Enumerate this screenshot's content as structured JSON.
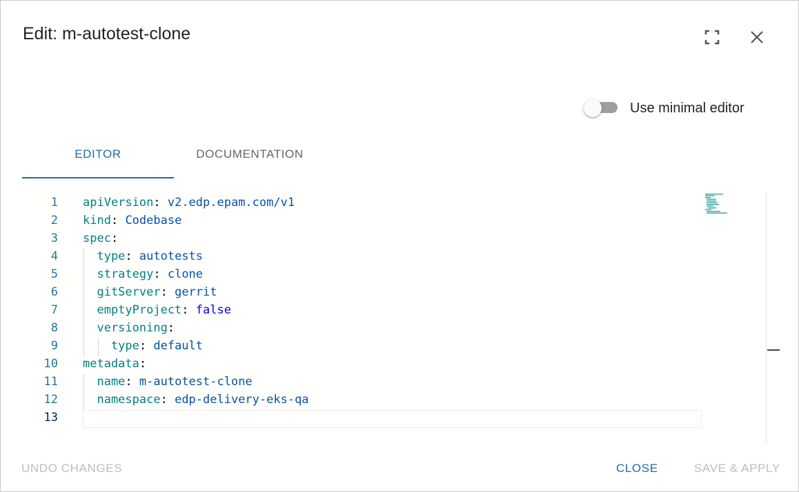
{
  "dialog": {
    "title": "Edit: m-autotest-clone",
    "icons": {
      "fullscreen": "fullscreen-icon",
      "close": "close-icon"
    }
  },
  "toggle": {
    "label": "Use minimal editor",
    "checked": false
  },
  "tabs": [
    {
      "label": "EDITOR",
      "active": true
    },
    {
      "label": "DOCUMENTATION",
      "active": false
    }
  ],
  "editor": {
    "lines": [
      {
        "num": "1",
        "key": "apiVersion",
        "sep": ":",
        "value": " v2.edp.epam.com/v1",
        "vtype": "v"
      },
      {
        "num": "2",
        "key": "kind",
        "sep": ":",
        "value": " Codebase",
        "vtype": "v"
      },
      {
        "num": "3",
        "key": "spec",
        "sep": ":",
        "value": "",
        "vtype": "v"
      },
      {
        "num": "4",
        "key": "  type",
        "sep": ":",
        "value": " autotests",
        "vtype": "v"
      },
      {
        "num": "5",
        "key": "  strategy",
        "sep": ":",
        "value": " clone",
        "vtype": "v"
      },
      {
        "num": "6",
        "key": "  gitServer",
        "sep": ":",
        "value": " gerrit",
        "vtype": "v"
      },
      {
        "num": "7",
        "key": "  emptyProject",
        "sep": ":",
        "value": " false",
        "vtype": "b"
      },
      {
        "num": "8",
        "key": "  versioning",
        "sep": ":",
        "value": "",
        "vtype": "v"
      },
      {
        "num": "9",
        "key": "    type",
        "sep": ":",
        "value": " default",
        "vtype": "v"
      },
      {
        "num": "10",
        "key": "metadata",
        "sep": ":",
        "value": "",
        "vtype": "v"
      },
      {
        "num": "11",
        "key": "  name",
        "sep": ":",
        "value": " m-autotest-clone",
        "vtype": "v"
      },
      {
        "num": "12",
        "key": "  namespace",
        "sep": ":",
        "value": " edp-delivery-eks-qa",
        "vtype": "v"
      },
      {
        "num": "13",
        "key": "",
        "sep": "",
        "value": "",
        "vtype": "v"
      }
    ],
    "current_line": "13"
  },
  "footer": {
    "undo_label": "UNDO CHANGES",
    "close_label": "CLOSE",
    "save_label": "SAVE & APPLY"
  },
  "colors": {
    "accent": "#1e6aa8",
    "disabled": "#bdbdbd",
    "yaml_key": "#008080",
    "yaml_value": "#0451a5",
    "yaml_boolean": "#0000ff",
    "line_number": "#237893"
  }
}
